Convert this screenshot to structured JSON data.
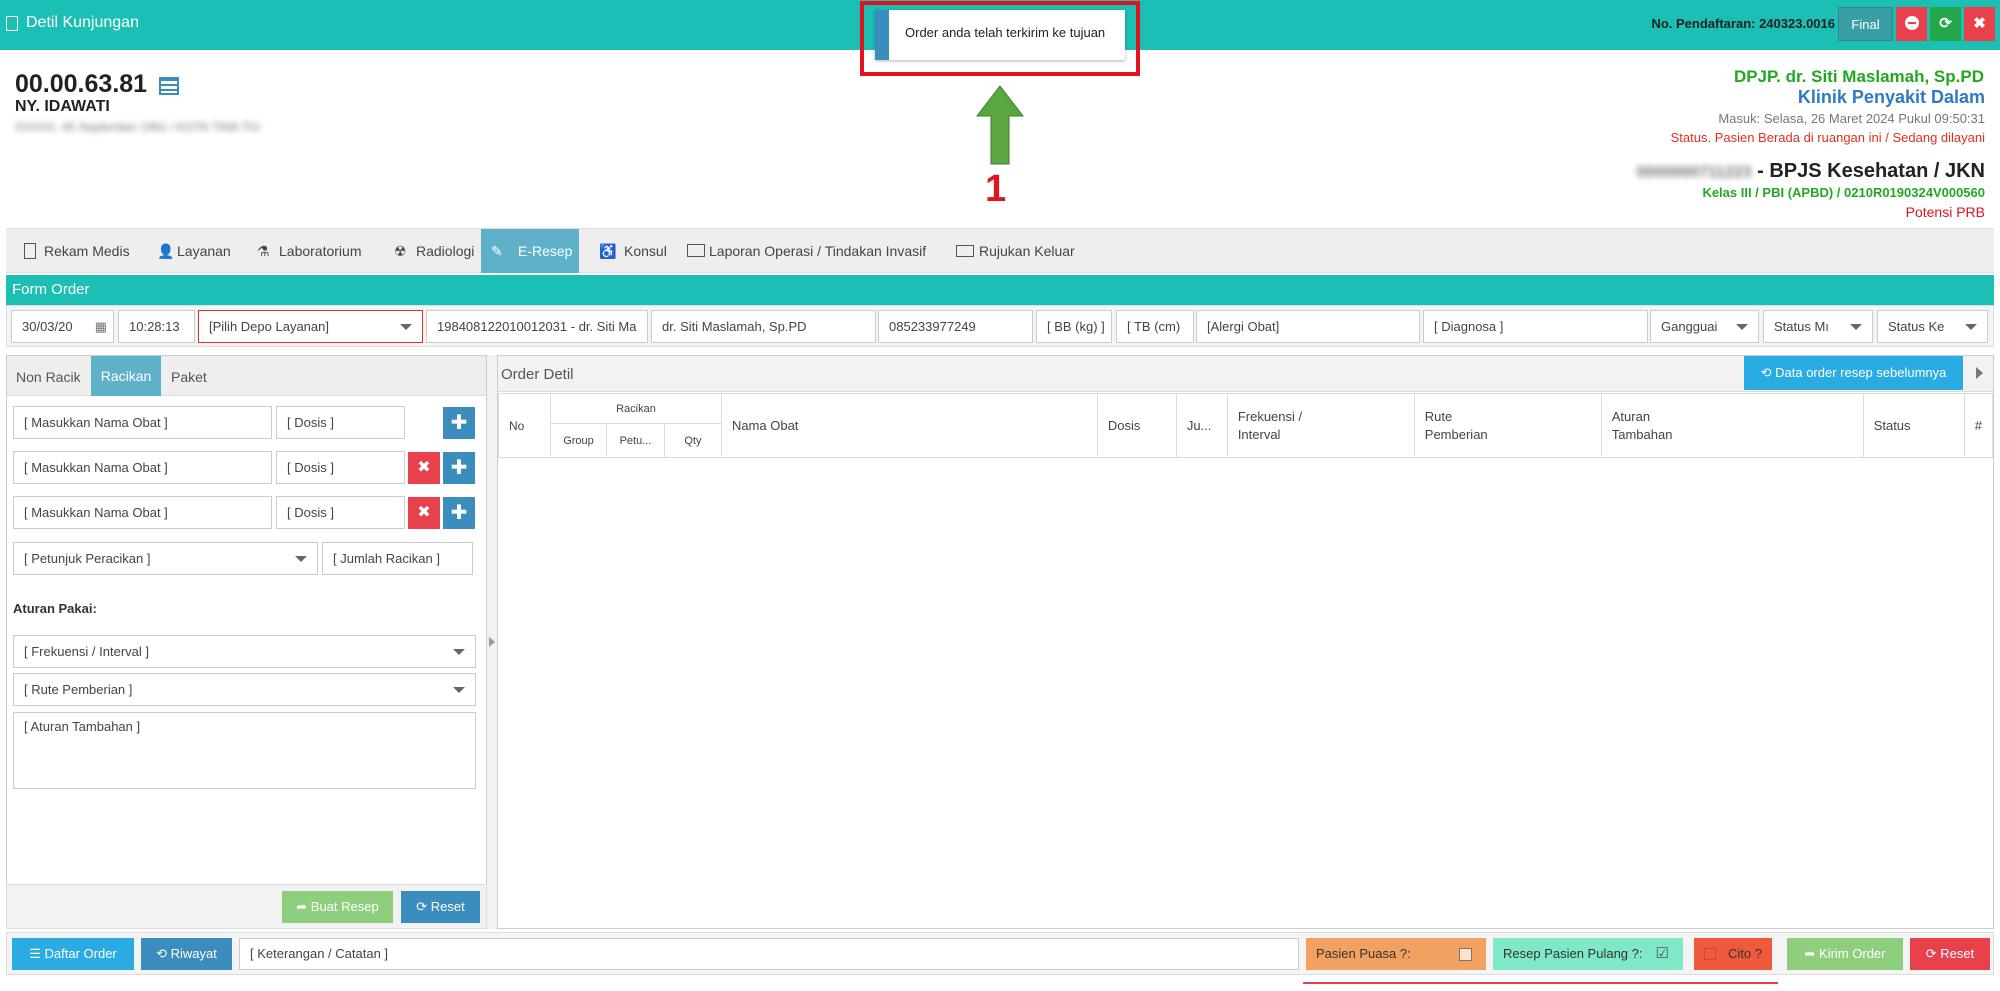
{
  "header": {
    "title": "Detil Kunjungan",
    "reg_label": "No. Pendaftaran: 240323.0016",
    "final_label": "Final"
  },
  "toast": {
    "message": "Order anda telah terkirim ke tujuan"
  },
  "annotation": {
    "number": "1"
  },
  "patient": {
    "mrn": "00.00.63.81",
    "name": "NY. IDAWATI",
    "address": "XXXXX, 45 September 1961 / KOTA TINA TIU"
  },
  "visit": {
    "dpjp": "DPJP. dr. Siti Maslamah, Sp.PD",
    "clinic": "Klinik Penyakit Dalam",
    "entry": "Masuk: Selasa, 26 Maret 2024 Pukul 09:50:31",
    "status": "Status. Pasien Berada di ruangan ini / Sedang dilayani",
    "insurance_id": "0000000711223",
    "insurance": " - BPJS Kesehatan / JKN",
    "class": "Kelas III / PBI (APBD) / 0210R0190324V000560",
    "prb": "Potensi PRB"
  },
  "tabs": [
    {
      "label": "Rekam Medis"
    },
    {
      "label": "Layanan"
    },
    {
      "label": "Laboratorium"
    },
    {
      "label": "Radiologi"
    },
    {
      "label": "E-Resep"
    },
    {
      "label": "Konsul"
    },
    {
      "label": "Laporan Operasi / Tindakan Invasif"
    },
    {
      "label": "Rujukan Keluar"
    }
  ],
  "form": {
    "title": "Form Order",
    "date": "30/03/20",
    "time": "10:28:13",
    "depo": "[Pilih Depo Layanan]",
    "doctor_id": "198408122010012031 - dr. Siti Ma",
    "doctor": "dr. Siti Maslamah, Sp.PD",
    "phone": "085233977249",
    "bb": "[ BB (kg) ]",
    "tb": "[ TB (cm)",
    "alergi": "[Alergi Obat]",
    "diagnosa": "[ Diagnosa ]",
    "gangguan": "Gangguai",
    "status_m": "Status Mı",
    "status_k": "Status Ke"
  },
  "left": {
    "subtabs": [
      {
        "label": "Non Racik"
      },
      {
        "label": "Racikan"
      },
      {
        "label": "Paket"
      }
    ],
    "drug_ph": "[ Masukkan Nama Obat ]",
    "dose_ph": "[ Dosis ]",
    "petunjuk": "[ Petunjuk Peracikan ]",
    "jumlah": "[ Jumlah Racikan ]",
    "aturan_label": "Aturan Pakai:",
    "frek": "[ Frekuensi / Interval ]",
    "rute": "[ Rute Pemberian ]",
    "aturan_tambahan": "[ Aturan Tambahan ]",
    "buat": "Buat Resep",
    "reset": "Reset"
  },
  "order": {
    "title": "Order Detil",
    "prev_btn": "Data order resep sebelumnya",
    "cols": {
      "no": "No",
      "racikan": "Racikan",
      "group": "Group",
      "petu": "Petu...",
      "qty": "Qty",
      "nama": "Nama Obat",
      "dosis": "Dosis",
      "ju": "Ju...",
      "frek1": "Frekuensi /",
      "frek2": "Interval",
      "rute1": "Rute",
      "rute2": "Pemberian",
      "at1": "Aturan",
      "at2": "Tambahan",
      "status": "Status",
      "hash": "#"
    }
  },
  "bottom": {
    "daftar": "Daftar Order",
    "riwayat": "Riwayat",
    "ket": "[ Keterangan / Catatan ]",
    "puasa": "Pasien Puasa ?:",
    "pulang": "Resep Pasien Pulang ?:",
    "cito": "Cito ?",
    "kirim": "Kirim Order",
    "reset": "Reset"
  },
  "colors": {
    "teal": "#1cbfb4",
    "blue": "#3b8dbd",
    "red": "#e8414b",
    "green": "#22a84a"
  }
}
